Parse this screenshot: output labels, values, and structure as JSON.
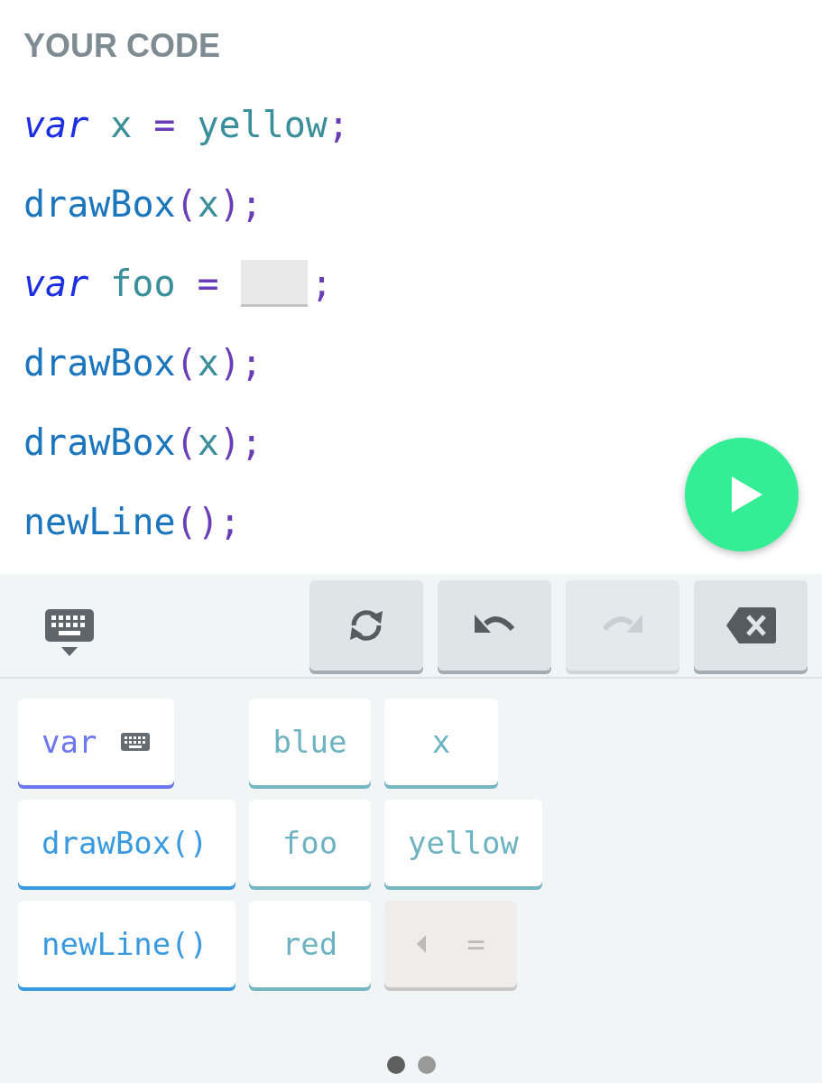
{
  "title": "YOUR CODE",
  "code_lines": [
    [
      {
        "kind": "keyword",
        "text": "var"
      },
      {
        "kind": "ident",
        "text": "x"
      },
      {
        "kind": "op",
        "text": "="
      },
      {
        "kind": "ident",
        "text": "yellow"
      },
      {
        "kind": "punct",
        "text": ";"
      }
    ],
    [
      {
        "kind": "func",
        "text": "drawBox"
      },
      {
        "kind": "punct",
        "text": "("
      },
      {
        "kind": "ident",
        "text": "x"
      },
      {
        "kind": "punct",
        "text": ");"
      }
    ],
    [
      {
        "kind": "keyword",
        "text": "var"
      },
      {
        "kind": "ident",
        "text": "foo"
      },
      {
        "kind": "op",
        "text": "="
      },
      {
        "kind": "blank"
      },
      {
        "kind": "punct",
        "text": ";"
      }
    ],
    [
      {
        "kind": "func",
        "text": "drawBox"
      },
      {
        "kind": "punct",
        "text": "("
      },
      {
        "kind": "ident",
        "text": "x"
      },
      {
        "kind": "punct",
        "text": ");"
      }
    ],
    [
      {
        "kind": "func",
        "text": "drawBox"
      },
      {
        "kind": "punct",
        "text": "("
      },
      {
        "kind": "ident",
        "text": "x"
      },
      {
        "kind": "punct",
        "text": ");"
      }
    ],
    [
      {
        "kind": "func",
        "text": "newLine"
      },
      {
        "kind": "punct",
        "text": "();"
      }
    ]
  ],
  "toolbar": [
    {
      "kind": "refresh",
      "disabled": false
    },
    {
      "kind": "undo",
      "disabled": false
    },
    {
      "kind": "redo",
      "disabled": true
    },
    {
      "kind": "delete",
      "disabled": false
    }
  ],
  "palette": [
    [
      {
        "kind": "keyword",
        "text": "var",
        "disabled": false
      },
      {
        "kind": "value",
        "text": "blue",
        "disabled": false
      },
      {
        "kind": "value",
        "text": "x",
        "disabled": false
      }
    ],
    [
      {
        "kind": "func",
        "text": "drawBox()",
        "disabled": false
      },
      {
        "kind": "value",
        "text": "foo",
        "disabled": false
      },
      {
        "kind": "value",
        "text": "yellow",
        "disabled": false
      }
    ],
    [
      {
        "kind": "func",
        "text": "newLine()",
        "disabled": false
      },
      {
        "kind": "value",
        "text": "red",
        "disabled": false
      },
      {
        "kind": "operator",
        "text": "=",
        "disabled": true
      }
    ]
  ],
  "pages": [
    {
      "selected": true
    },
    {
      "selected": false
    }
  ]
}
